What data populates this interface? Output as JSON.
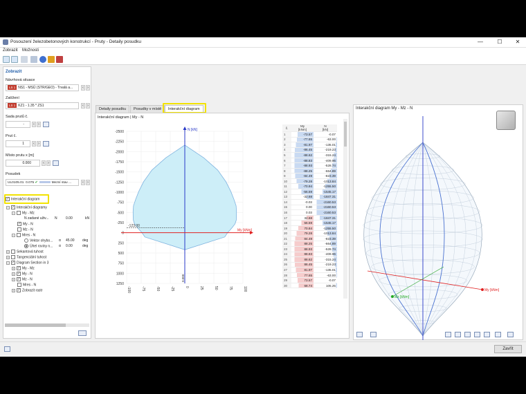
{
  "window": {
    "title": "Posouzení železobetonových konstrukcí - Pruty - Detaily posudku",
    "minimize": "—",
    "maximize": "☐",
    "close": "✕"
  },
  "menu": [
    "Zobrazit",
    "Možnosti"
  ],
  "left": {
    "header": "Zobrazit",
    "design_situation_label": "Návrhová situace",
    "design_situation_badge": "LS 1",
    "design_situation_value": "NS1 - MSÚ (STR/GEO) - Trvalá a...",
    "loading_label": "Zatížení",
    "loading_badge": "LS 1",
    "loading_value": "KZ1 - 1.35 * ZS1",
    "member_set_label": "Sada prutů č.",
    "member_set_value": "-",
    "member_label": "Prut č.",
    "member_value": "1",
    "location_label": "Místo prutu x [m]",
    "location_value": "0.000",
    "check_label": "Posudek",
    "check_id": "UL0105.01",
    "check_ratio": "0.075",
    "check_desc": "Mezní stav ...",
    "interaction_checkbox": "Interakční diagram",
    "tree": [
      {
        "label": "Interakční diagramy"
      },
      {
        "label": "My - Mz"
      },
      {
        "label": "N zadané uživ...",
        "col1": "N",
        "col2": "0.00",
        "col3": "kN"
      },
      {
        "label": "My - N"
      },
      {
        "label": "Mz - N"
      },
      {
        "label": "Mres - N"
      },
      {
        "label": "Vektor ohybo...",
        "col1": "α",
        "col2": "45.00",
        "col3": "deg"
      },
      {
        "label": "Úhel roviny n...",
        "col1": "α",
        "col2": "0.00",
        "col3": "deg"
      },
      {
        "label": "Sekantová tuhost"
      },
      {
        "label": "Tangenciální tuhost"
      },
      {
        "label": "Diagram Section in 3"
      },
      {
        "label": "My - Mz"
      },
      {
        "label": "My - N"
      },
      {
        "label": "Mz - N"
      },
      {
        "label": "Mres - N"
      },
      {
        "label": "Zobrazit rastr"
      }
    ]
  },
  "tabs": [
    "Detaily posudku",
    "Posudky v místě",
    "Interakční diagram"
  ],
  "middle": {
    "title": "Interakční diagram | My - N",
    "table_headers": {
      "idx": "č.",
      "my": "My",
      "my_unit": "[kNm]",
      "n": "N",
      "n_unit": "[kN]"
    },
    "rows": [
      [
        "1",
        "-73.57",
        "-0.07"
      ],
      [
        "2",
        "-77.65",
        "-63.00"
      ],
      [
        "3",
        "-81.97",
        "-135.01"
      ],
      [
        "4",
        "-86.45",
        "-219.23"
      ],
      [
        "5",
        "-88.62",
        "-315.24"
      ],
      [
        "6",
        "-88.83",
        "-409.96"
      ],
      [
        "7",
        "-88.93",
        "-528.74"
      ],
      [
        "8",
        "-88.25",
        "-664.89"
      ],
      [
        "9",
        "-84.49",
        "-823.39"
      ],
      [
        "10",
        "-79.28",
        "-1013.84"
      ],
      [
        "11",
        "-70.94",
        "-1255.50"
      ],
      [
        "12",
        "-56.59",
        "-1545.17"
      ],
      [
        "13",
        "-32.68",
        "-1847.31"
      ],
      [
        "14",
        "-0.03",
        "-2160.53"
      ],
      [
        "15",
        "0.00",
        "-2160.53"
      ],
      [
        "16",
        "0.03",
        "-2160.53"
      ],
      [
        "17",
        "32.68",
        "-1847.31"
      ],
      [
        "18",
        "56.59",
        "-1545.17"
      ],
      [
        "19",
        "70.84",
        "-1255.50"
      ],
      [
        "20",
        "79.28",
        "-1013.84"
      ],
      [
        "21",
        "84.49",
        "-823.39"
      ],
      [
        "22",
        "88.25",
        "-664.89"
      ],
      [
        "23",
        "88.93",
        "-528.74"
      ],
      [
        "24",
        "88.83",
        "-409.96"
      ],
      [
        "25",
        "88.62",
        "-315.24"
      ],
      [
        "26",
        "86.45",
        "-219.23"
      ],
      [
        "27",
        "81.97",
        "-135.01"
      ],
      [
        "28",
        "77.65",
        "-63.00"
      ],
      [
        "29",
        "73.57",
        "-0.07"
      ],
      [
        "30",
        "68.74",
        "105.25"
      ]
    ]
  },
  "chart_data": {
    "type": "line",
    "title": "Interakční diagram | My - N",
    "xlabel": "My [kNm]",
    "ylabel": "N [kN]",
    "xlim": [
      -100,
      100
    ],
    "ylim": [
      1250,
      -2500
    ],
    "x_ticks": [
      "-100",
      "-75",
      "-50",
      "-25",
      "0",
      "25",
      "50",
      "75",
      "100"
    ],
    "y_ticks": [
      "-2500",
      "-2250",
      "-2000",
      "-1750",
      "-1500",
      "-1250",
      "-1000",
      "-750",
      "-500",
      "-250",
      "0",
      "250",
      "500",
      "750",
      "1000",
      "1250"
    ],
    "annotations": [
      "-123.00",
      "0.000"
    ],
    "series": [
      {
        "x": [
          -73.57,
          -77.65,
          -81.97,
          -86.45,
          -88.62,
          -88.83,
          -88.93,
          -88.25,
          -84.49,
          -79.28,
          -70.94,
          -56.59,
          -32.68,
          -0.03,
          0.03,
          32.68,
          56.59,
          70.84,
          79.28,
          84.49,
          88.25,
          88.93,
          88.83,
          88.62,
          86.45,
          81.97,
          77.65,
          73.57,
          68.74,
          0,
          -68.74
        ],
        "y": [
          -0.07,
          -63,
          -135.01,
          -219.23,
          -315.24,
          -409.96,
          -528.74,
          -664.89,
          -823.39,
          -1013.84,
          -1255.5,
          -1545.17,
          -1847.31,
          -2160.53,
          -2160.53,
          -1847.31,
          -1545.17,
          -1255.5,
          -1013.84,
          -823.39,
          -664.89,
          -528.74,
          -409.96,
          -315.24,
          -219.23,
          -135.01,
          -63,
          -0.07,
          105.25,
          420,
          105.25
        ]
      }
    ]
  },
  "right": {
    "title": "Interakční diagram My - Mz - N",
    "axis_my": "My [kNm]",
    "axis_mz": "Mz [kNm]",
    "axis_n": "N [kN]"
  },
  "footer": {
    "close_label": "Zavřít"
  },
  "colors": {
    "fill": "#cdeef8",
    "line": "#7fb3df",
    "axis_n": "#2838c8",
    "axis_my": "#e02020",
    "highlight": "#f2e200"
  }
}
